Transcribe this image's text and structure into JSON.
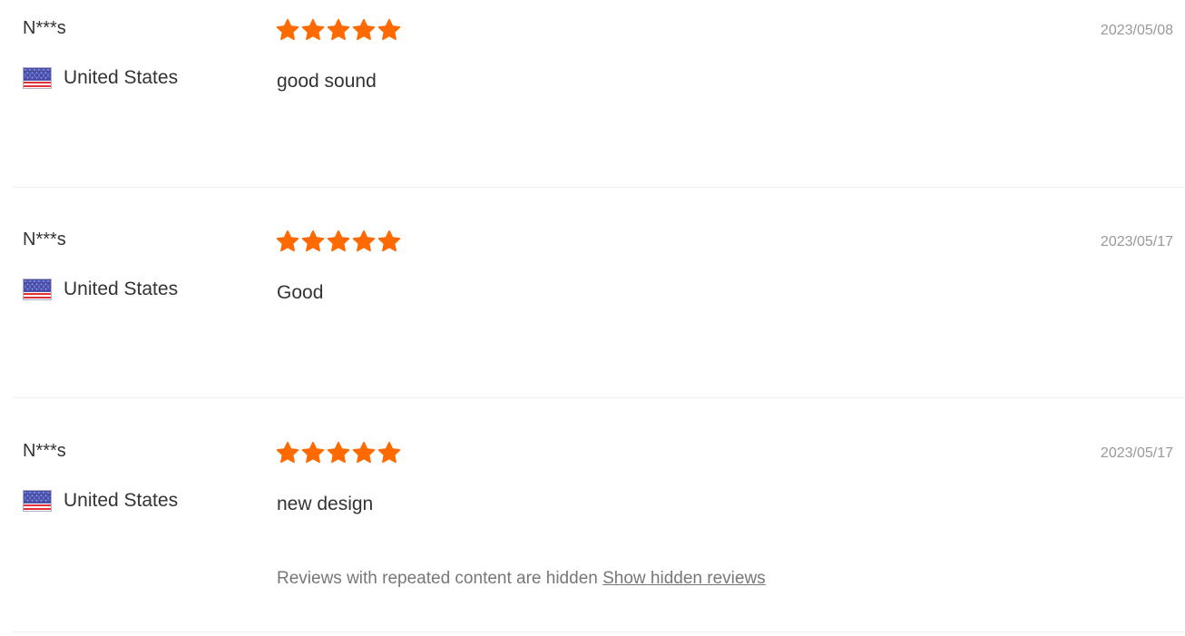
{
  "reviews": [
    {
      "user": "N***s",
      "country": "United States",
      "rating": 5,
      "text": "good sound",
      "date": "2023/05/08"
    },
    {
      "user": "N***s",
      "country": "United States",
      "rating": 5,
      "text": "Good",
      "date": "2023/05/17"
    },
    {
      "user": "N***s",
      "country": "United States",
      "rating": 5,
      "text": "new design",
      "date": "2023/05/17"
    }
  ],
  "hidden_notice": {
    "text": "Reviews with repeated content are hidden",
    "link": "Show hidden reviews"
  },
  "colors": {
    "star": "#ff6a00",
    "text": "#333333",
    "muted": "#999999",
    "divider": "#eeeeee"
  },
  "icons": {
    "flag": "us-flag-icon",
    "star": "star-icon"
  }
}
